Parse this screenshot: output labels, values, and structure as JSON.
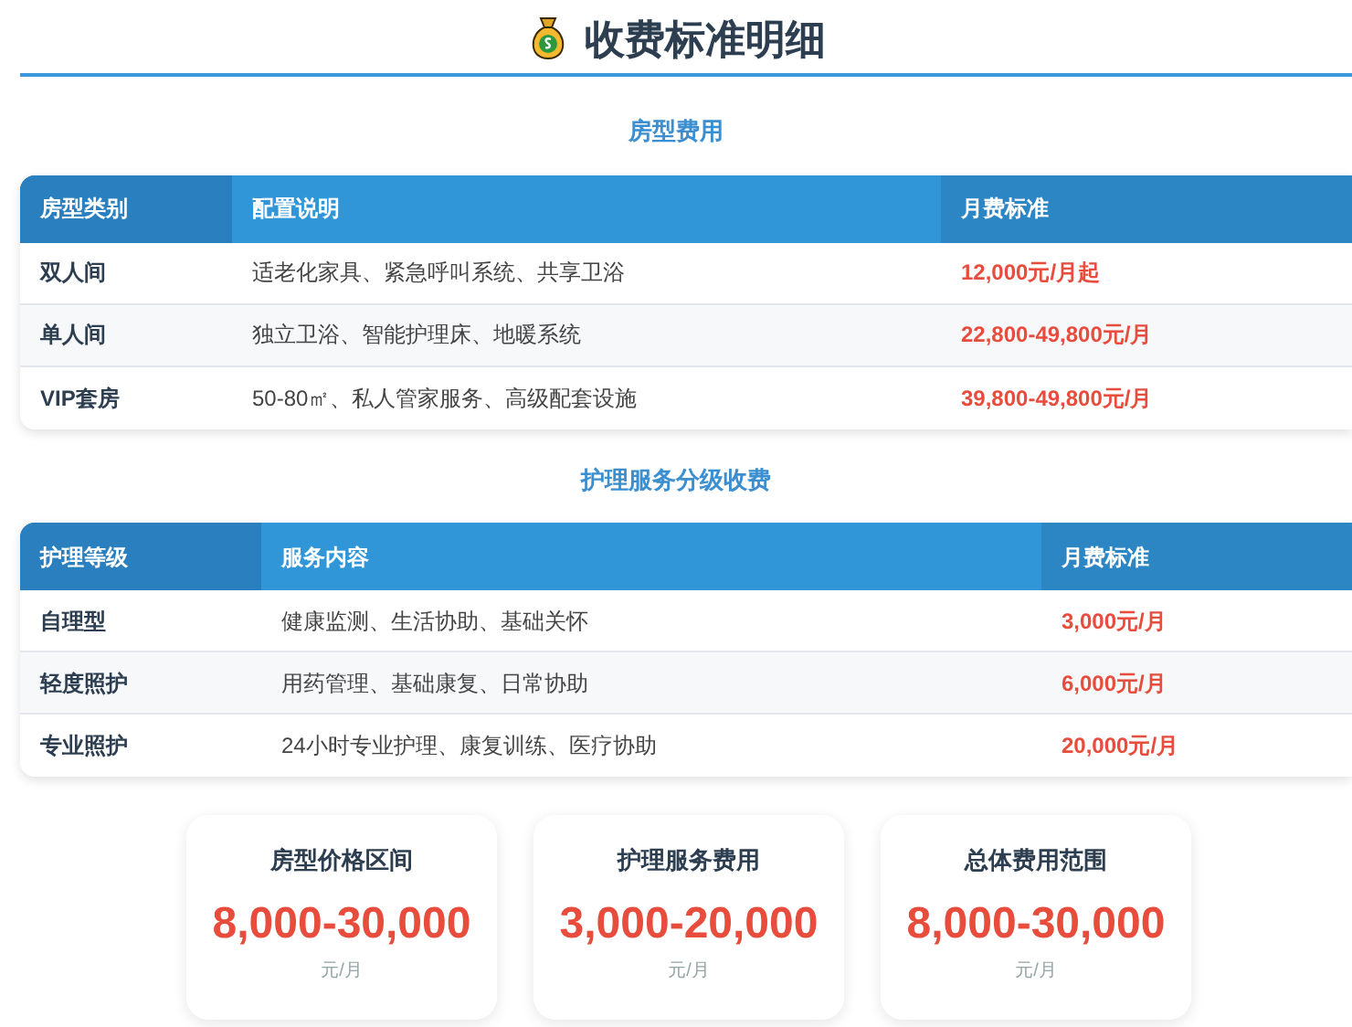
{
  "title": "收费标准明细",
  "sections": [
    {
      "heading": "房型费用",
      "columns": [
        "房型类别",
        "配置说明",
        "月费标准"
      ],
      "rows": [
        {
          "name": "双人间",
          "desc": "适老化家具、紧急呼叫系统、共享卫浴",
          "price": "12,000元/月起"
        },
        {
          "name": "单人间",
          "desc": "独立卫浴、智能护理床、地暖系统",
          "price": "22,800-49,800元/月"
        },
        {
          "name": "VIP套房",
          "desc": "50-80㎡、私人管家服务、高级配套设施",
          "price": "39,800-49,800元/月"
        }
      ]
    },
    {
      "heading": "护理服务分级收费",
      "columns": [
        "护理等级",
        "服务内容",
        "月费标准"
      ],
      "rows": [
        {
          "name": "自理型",
          "desc": "健康监测、生活协助、基础关怀",
          "price": "3,000元/月"
        },
        {
          "name": "轻度照护",
          "desc": "用药管理、基础康复、日常协助",
          "price": "6,000元/月"
        },
        {
          "name": "专业照护",
          "desc": "24小时专业护理、康复训练、医疗协助",
          "price": "20,000元/月"
        }
      ]
    }
  ],
  "summary": [
    {
      "label": "房型价格区间",
      "value": "8,000-30,000",
      "unit": "元/月"
    },
    {
      "label": "护理服务费用",
      "value": "3,000-20,000",
      "unit": "元/月"
    },
    {
      "label": "总体费用范围",
      "value": "8,000-30,000",
      "unit": "元/月"
    }
  ]
}
